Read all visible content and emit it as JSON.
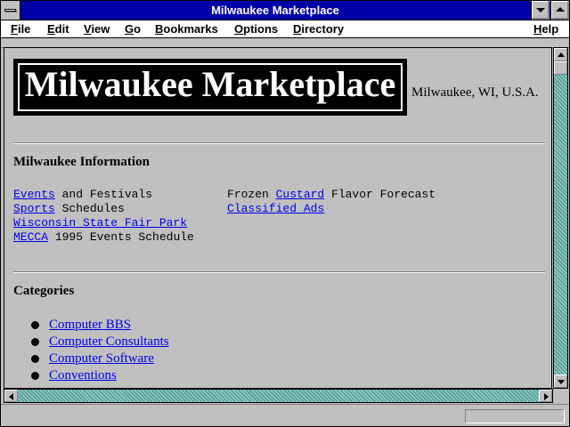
{
  "window": {
    "title": "Milwaukee Marketplace"
  },
  "menu": [
    {
      "underline": "F",
      "rest": "ile"
    },
    {
      "underline": "E",
      "rest": "dit"
    },
    {
      "underline": "V",
      "rest": "iew"
    },
    {
      "underline": "G",
      "rest": "o"
    },
    {
      "underline": "B",
      "rest": "ookmarks"
    },
    {
      "underline": "O",
      "rest": "ptions"
    },
    {
      "underline": "D",
      "rest": "irectory"
    },
    {
      "underline": "H",
      "rest": "elp"
    }
  ],
  "page": {
    "logo_text": "Milwaukee Marketplace",
    "location": "Milwaukee, WI, U.S.A.",
    "info_heading": "Milwaukee Information",
    "info_left": [
      {
        "link": "Events",
        "text": " and Festivals"
      },
      {
        "link": "Sports",
        "text": " Schedules"
      },
      {
        "link": "Wisconsin State Fair Park",
        "text": ""
      },
      {
        "link": "MECCA",
        "text": " 1995 Events Schedule"
      }
    ],
    "info_right": [
      {
        "pre": "Frozen ",
        "link": "Custard",
        "text": " Flavor Forecast"
      },
      {
        "pre": "",
        "link": "Classified Ads",
        "text": ""
      }
    ],
    "categories_heading": "Categories",
    "categories": [
      "Computer BBS",
      "Computer Consultants",
      "Computer Software",
      "Conventions"
    ]
  },
  "status": {
    "text": "",
    "progress": 0
  },
  "colors": {
    "titlebar": "#0000a8",
    "link": "#0000ee",
    "scroll_track": "#5fa8a0"
  }
}
